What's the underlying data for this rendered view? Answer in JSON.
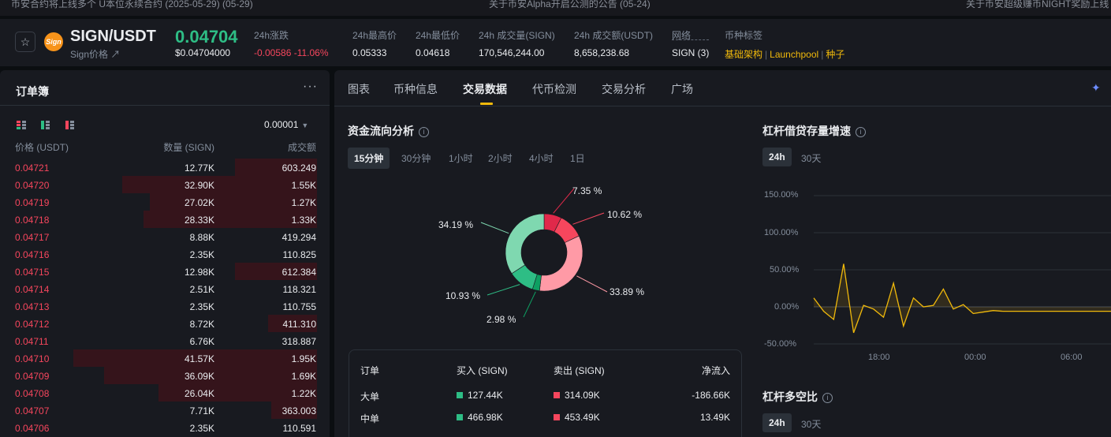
{
  "top_strip": {
    "left": "币安合约将上线多个 U本位永续合约 (2025-05-29) (05-29)",
    "center": "关于币安Alpha开启公测的公告 (05-24)",
    "right": "关于币安超级赚币NIGHT奖励上线"
  },
  "header": {
    "pair": "SIGN/USDT",
    "pair_sub": "Sign价格 ↗",
    "last_price": "0.04704",
    "last_price_usd": "$0.04704000",
    "stats": [
      {
        "label": "24h涨跌",
        "value": "-0.00586 -11.06%",
        "color": "red"
      },
      {
        "label": "24h最高价",
        "value": "0.05333"
      },
      {
        "label": "24h最低价",
        "value": "0.04618"
      },
      {
        "label": "24h 成交量(SIGN)",
        "value": "170,546,244.00"
      },
      {
        "label": "24h 成交额(USDT)",
        "value": "8,658,238.68"
      },
      {
        "label": "网络",
        "value": "SIGN (3)"
      }
    ],
    "tags_label": "币种标签",
    "tags": [
      "基础架构",
      "Launchpool",
      "种子"
    ]
  },
  "orderbook": {
    "title": "订单簿",
    "tick_size": "0.00001",
    "col_price": "价格 (USDT)",
    "col_qty": "数量 (SIGN)",
    "col_total": "成交额",
    "rows": [
      {
        "price": "0.04721",
        "qty": "12.77K",
        "total": "603.249",
        "depth": 0.27
      },
      {
        "price": "0.04720",
        "qty": "32.90K",
        "total": "1.55K",
        "depth": 0.64
      },
      {
        "price": "0.04719",
        "qty": "27.02K",
        "total": "1.27K",
        "depth": 0.55
      },
      {
        "price": "0.04718",
        "qty": "28.33K",
        "total": "1.33K",
        "depth": 0.57
      },
      {
        "price": "0.04717",
        "qty": "8.88K",
        "total": "419.294",
        "depth": 0.0
      },
      {
        "price": "0.04716",
        "qty": "2.35K",
        "total": "110.825",
        "depth": 0.0
      },
      {
        "price": "0.04715",
        "qty": "12.98K",
        "total": "612.384",
        "depth": 0.27
      },
      {
        "price": "0.04714",
        "qty": "2.51K",
        "total": "118.321",
        "depth": 0.0
      },
      {
        "price": "0.04713",
        "qty": "2.35K",
        "total": "110.755",
        "depth": 0.0
      },
      {
        "price": "0.04712",
        "qty": "8.72K",
        "total": "411.310",
        "depth": 0.16
      },
      {
        "price": "0.04711",
        "qty": "6.76K",
        "total": "318.887",
        "depth": 0.0
      },
      {
        "price": "0.04710",
        "qty": "41.57K",
        "total": "1.95K",
        "depth": 0.8
      },
      {
        "price": "0.04709",
        "qty": "36.09K",
        "total": "1.69K",
        "depth": 0.7
      },
      {
        "price": "0.04708",
        "qty": "26.04K",
        "total": "1.22K",
        "depth": 0.52
      },
      {
        "price": "0.04707",
        "qty": "7.71K",
        "total": "363.003",
        "depth": 0.15
      },
      {
        "price": "0.04706",
        "qty": "2.35K",
        "total": "110.591",
        "depth": 0.0
      }
    ]
  },
  "tabs": [
    "图表",
    "币种信息",
    "交易数据",
    "代币检测",
    "交易分析",
    "广场"
  ],
  "active_tab": "交易数据",
  "fund_flow": {
    "title": "资金流向分析",
    "timeframes": [
      "15分钟",
      "30分钟",
      "1小时",
      "2小时",
      "4小时",
      "1日"
    ],
    "active_timeframe": "15分钟",
    "chart_data": {
      "type": "pie",
      "slices": [
        {
          "label": "7.35 %",
          "value": 7.35,
          "color": "#e0294a"
        },
        {
          "label": "10.62 %",
          "value": 10.62,
          "color": "#f6465d"
        },
        {
          "label": "33.89 %",
          "value": 33.89,
          "color": "#ff9aa6"
        },
        {
          "label": "2.98 %",
          "value": 2.98,
          "color": "#0e9f62"
        },
        {
          "label": "10.93 %",
          "value": 10.93,
          "color": "#2ebd85"
        },
        {
          "label": "34.19 %",
          "value": 34.19,
          "color": "#7fd8b0"
        }
      ]
    },
    "table": {
      "headers": [
        "订单",
        "买入 (SIGN)",
        "卖出 (SIGN)",
        "净流入"
      ],
      "rows": [
        {
          "label": "大单",
          "buy": "127.44K",
          "sell": "314.09K",
          "net": "-186.66K"
        },
        {
          "label": "中单",
          "buy": "466.98K",
          "sell": "453.49K",
          "net": "13.49K"
        }
      ]
    }
  },
  "margin_growth": {
    "title": "杠杆借贷存量增速",
    "timeframes": [
      "24h",
      "30天"
    ],
    "active_timeframe": "24h",
    "chart_data": {
      "type": "line",
      "y_ticks": [
        "150.00%",
        "100.00%",
        "50.00%",
        "0.00%",
        "-50.00%"
      ],
      "x_ticks": [
        "18:00",
        "00:00",
        "06:00"
      ],
      "ylim": [
        -50,
        150
      ],
      "x": [
        0,
        1,
        2,
        3,
        4,
        5,
        6,
        7,
        8,
        9,
        10,
        11,
        12,
        13,
        14,
        15,
        16,
        17,
        18,
        19,
        20,
        21,
        22,
        23,
        24,
        25,
        26,
        27,
        28,
        29,
        30,
        31
      ],
      "values": [
        12,
        -6,
        -17,
        58,
        -35,
        2,
        -3,
        -14,
        32,
        -26,
        12,
        0,
        2,
        24,
        -3,
        3,
        -9,
        -7,
        -5,
        -6,
        -6,
        -6,
        -6,
        -6,
        -6,
        -6,
        -6,
        -6,
        -6,
        -6,
        -6,
        -6
      ],
      "color": "#f0b90b"
    }
  },
  "long_short": {
    "title": "杠杆多空比",
    "timeframes": [
      "24h",
      "30天"
    ],
    "active_timeframe": "24h"
  }
}
